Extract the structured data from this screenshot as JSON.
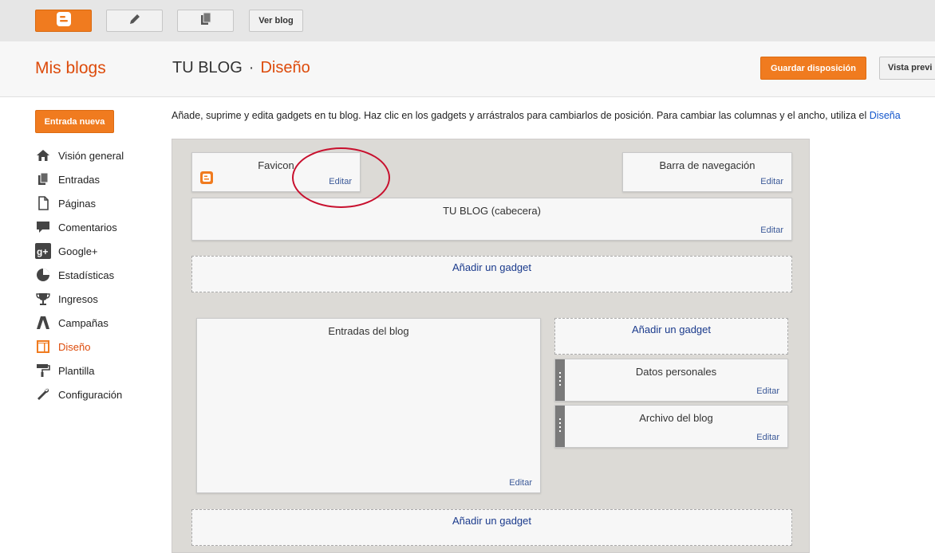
{
  "toolbar": {
    "view_blog_label": "Ver blog",
    "icons": [
      "blogger-icon",
      "pencil-icon",
      "pages-icon"
    ]
  },
  "header": {
    "my_blogs": "Mis blogs",
    "blog_name": "TU BLOG",
    "separator": "·",
    "section": "Diseño",
    "save_label": "Guardar disposición",
    "preview_label": "Vista previ"
  },
  "sidebar": {
    "new_post_label": "Entrada nueva",
    "items": [
      {
        "label": "Visión general",
        "icon": "home-icon"
      },
      {
        "label": "Entradas",
        "icon": "posts-icon"
      },
      {
        "label": "Páginas",
        "icon": "pages-icon"
      },
      {
        "label": "Comentarios",
        "icon": "comments-icon"
      },
      {
        "label": "Google+",
        "icon": "googleplus-icon"
      },
      {
        "label": "Estadísticas",
        "icon": "stats-icon"
      },
      {
        "label": "Ingresos",
        "icon": "trophy-icon"
      },
      {
        "label": "Campañas",
        "icon": "adwords-icon"
      },
      {
        "label": "Diseño",
        "icon": "layout-icon",
        "active": true
      },
      {
        "label": "Plantilla",
        "icon": "paint-roller-icon"
      },
      {
        "label": "Configuración",
        "icon": "wrench-icon"
      }
    ]
  },
  "description": {
    "text": "Añade, suprime y edita gadgets en tu blog. Haz clic en los gadgets y arrástralos para cambiarlos de posición. Para cambiar las columnas y el ancho, utiliza el ",
    "link": "Diseña"
  },
  "layout": {
    "favicon": {
      "title": "Favicon",
      "edit": "Editar"
    },
    "navbar": {
      "title": "Barra de navegación",
      "edit": "Editar"
    },
    "header": {
      "title": "TU BLOG (cabecera)",
      "edit": "Editar"
    },
    "add_gadget": "Añadir un gadget",
    "posts": {
      "title": "Entradas del blog",
      "edit": "Editar"
    },
    "profile": {
      "title": "Datos personales",
      "edit": "Editar"
    },
    "archive": {
      "title": "Archivo del blog",
      "edit": "Editar"
    }
  },
  "colors": {
    "accent": "#f07b1f",
    "title_orange": "#dd4b0b",
    "link_blue": "#1a3a8c",
    "annotation_red": "#c8102e"
  }
}
